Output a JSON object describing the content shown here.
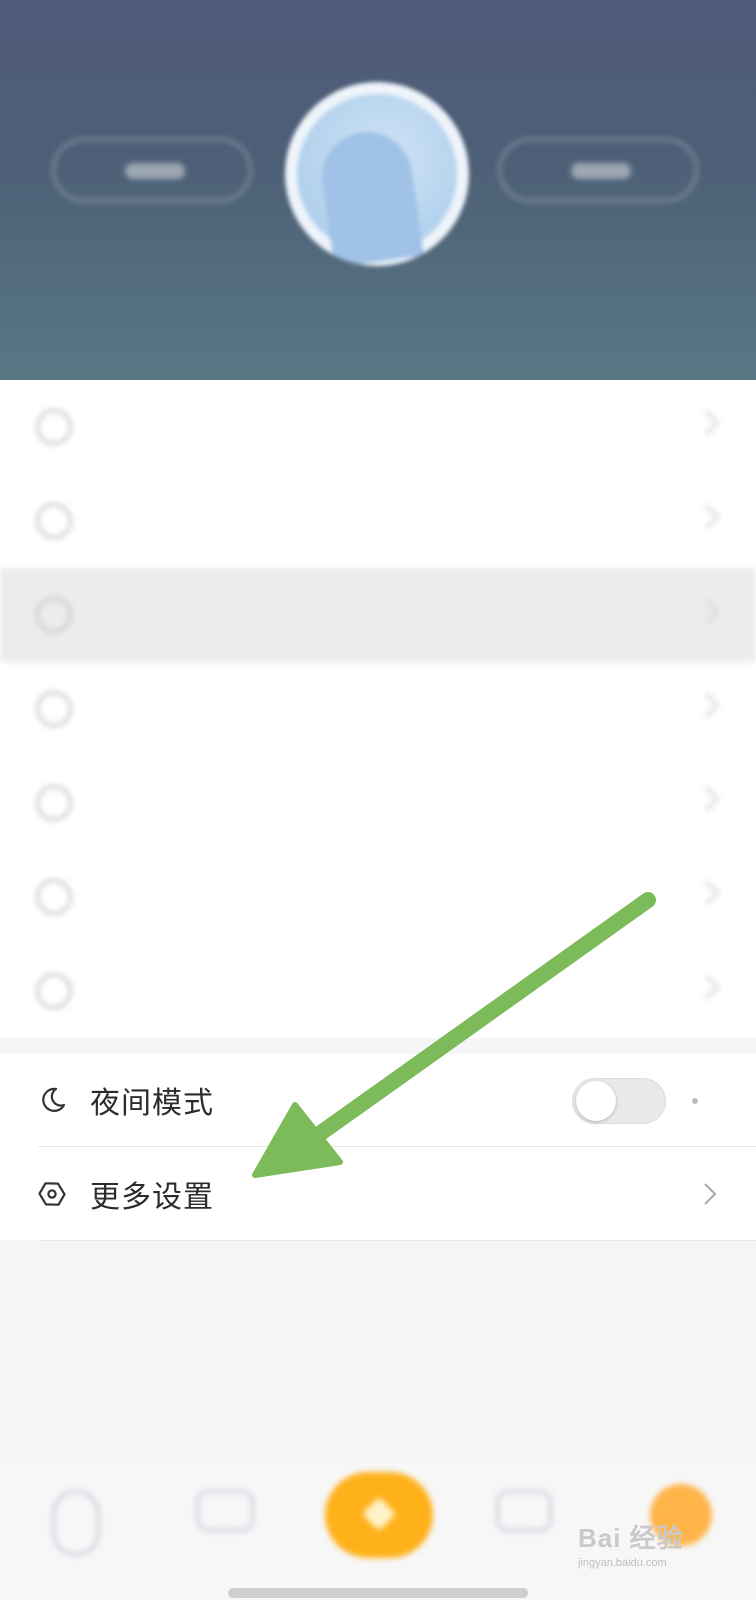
{
  "header": {
    "left_button_icon": "pill-button",
    "right_button_icon": "pill-button",
    "avatar_icon": "avatar-mascot"
  },
  "menu": {
    "items": [
      {
        "icon": "clock-icon",
        "label": ""
      },
      {
        "icon": "heart-icon",
        "label": ""
      },
      {
        "icon": "check-icon",
        "label": "",
        "highlighted": true
      },
      {
        "icon": "comment-icon",
        "label": ""
      },
      {
        "icon": "pen-icon",
        "label": ""
      },
      {
        "icon": "image-icon",
        "label": ""
      },
      {
        "icon": "play-icon",
        "label": ""
      }
    ]
  },
  "settings": {
    "night_mode": {
      "icon": "moon-icon",
      "label": "夜间模式",
      "enabled": false
    },
    "more_settings": {
      "icon": "hexagon-gear-icon",
      "label": "更多设置",
      "chevron": "chevron-right-icon"
    }
  },
  "annotation": {
    "arrow_color": "#7dbb5a"
  },
  "bottom_nav": {
    "items": [
      {
        "icon": "home-icon"
      },
      {
        "icon": "message-icon"
      },
      {
        "icon": "center-action-icon",
        "color": "#ffb11a"
      },
      {
        "icon": "chat-icon"
      },
      {
        "icon": "profile-icon",
        "color": "#ffb44a"
      }
    ]
  },
  "watermark": {
    "main": "Bai 经验",
    "sub": "jingyan.baidu.com"
  }
}
